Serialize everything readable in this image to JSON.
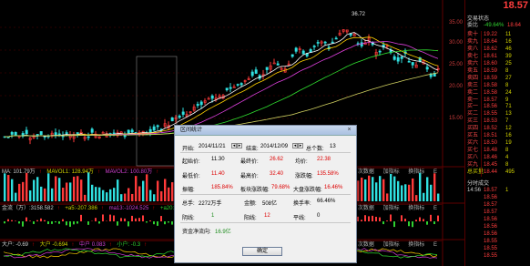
{
  "chart": {
    "peak_label": "36.72",
    "axis_labels": [
      "35.00",
      "30.00",
      "25.00",
      "20.00",
      "15.00"
    ]
  },
  "indicators": {
    "vol_bar": [
      "MA: 101.79万",
      "↑",
      "MAVOL1: 128.94万",
      "↑",
      "MAVOL2: 100.80万",
      "↑"
    ],
    "macd_bar": [
      "金流（万）:3158.582",
      "↑",
      "+a5:-207.386",
      "↑",
      "ma13:-1024.525",
      "↑",
      "+a20:-538.525",
      "↑"
    ],
    "last_bar": [
      "大户: -0.69",
      "↑",
      "大户 -0.694",
      "↑",
      "中户 0.083",
      "↑",
      "小户: -0.3",
      "↑"
    ],
    "tabs": [
      "次数据",
      "加指标",
      "换指标",
      "E"
    ]
  },
  "sidebar": {
    "price": "18.57",
    "title": "交易状态",
    "rate_label": "委比",
    "rate_value": "-49.64%",
    "rate_right": "18.64",
    "asks": [
      {
        "name": "卖十",
        "price": "19.22",
        "vol": "11"
      },
      {
        "name": "卖九",
        "price": "18.64",
        "vol": "16"
      },
      {
        "name": "卖八",
        "price": "18.62",
        "vol": "46"
      },
      {
        "name": "卖七",
        "price": "18.61",
        "vol": "39"
      },
      {
        "name": "卖六",
        "price": "18.60",
        "vol": "25"
      },
      {
        "name": "卖五",
        "price": "18.59",
        "vol": "8"
      },
      {
        "name": "卖四",
        "price": "18.59",
        "vol": "27"
      },
      {
        "name": "卖三",
        "price": "18.58",
        "vol": "8"
      },
      {
        "name": "卖二",
        "price": "18.58",
        "vol": "24"
      },
      {
        "name": "卖一",
        "price": "18.57",
        "vol": "9"
      }
    ],
    "bids": [
      {
        "name": "买一",
        "price": "18.56",
        "vol": "71"
      },
      {
        "name": "买二",
        "price": "18.55",
        "vol": "13"
      },
      {
        "name": "买三",
        "price": "18.53",
        "vol": "7"
      },
      {
        "name": "买四",
        "price": "18.52",
        "vol": "12"
      },
      {
        "name": "买五",
        "price": "18.51",
        "vol": "16"
      },
      {
        "name": "买六",
        "price": "18.50",
        "vol": "19"
      },
      {
        "name": "买七",
        "price": "18.48",
        "vol": "8"
      },
      {
        "name": "买八",
        "price": "18.46",
        "vol": "4"
      },
      {
        "name": "买九",
        "price": "18.45",
        "vol": "8"
      },
      {
        "name": "总买量",
        "price": "18.44",
        "vol": "495"
      }
    ],
    "ticks_title": "分时成交",
    "ticks": [
      {
        "time": "14:56",
        "price": "18.57",
        "vol": "1"
      },
      {
        "time": "",
        "price": "18.56",
        "vol": ""
      },
      {
        "time": "",
        "price": "18.57",
        "vol": ""
      },
      {
        "time": "",
        "price": "18.57",
        "vol": ""
      },
      {
        "time": "",
        "price": "18.56",
        "vol": ""
      },
      {
        "time": "",
        "price": "18.56",
        "vol": ""
      },
      {
        "time": "",
        "price": "18.56",
        "vol": ""
      },
      {
        "time": "",
        "price": "18.55",
        "vol": ""
      },
      {
        "time": "",
        "price": "18.55",
        "vol": ""
      },
      {
        "time": "",
        "price": "18.55",
        "vol": ""
      }
    ]
  },
  "dialog": {
    "title": "区间统计",
    "close": "×",
    "start_label": "开始:",
    "start_value": "2014/11/21",
    "end_label": "结束:",
    "end_value": "2014/12/09",
    "count_label": "总个数:",
    "count_value": "13",
    "open_label": "起始价:",
    "open_value": "11.30",
    "close_label": "最终价:",
    "close_value": "26.62",
    "avg_label": "均价:",
    "avg_value": "22.38",
    "low_label": "最低价:",
    "low_value": "11.40",
    "high_label": "最高价:",
    "high_value": "32.40",
    "chg_label": "涨跌幅:",
    "chg_value": "135.58%",
    "amp_label": "振幅:",
    "amp_value": "185.84%",
    "block_label": "板块涨跌幅:",
    "block_value": "79.68%",
    "market_label": "大盘涨跌幅:",
    "market_value": "16.46%",
    "vol_label": "总手:",
    "vol_value": "2272万手",
    "amt_label": "金额:",
    "amt_value": "508亿",
    "turn_label": "换手率:",
    "turn_value": "66.46%",
    "neg_label": "阴线:",
    "neg_value": "1",
    "pos_label": "阳线:",
    "pos_value": "12",
    "flat_label": "平线:",
    "flat_value": "0",
    "net_label": "资金净流向:",
    "net_value": "16.9亿",
    "ok": "确定"
  }
}
